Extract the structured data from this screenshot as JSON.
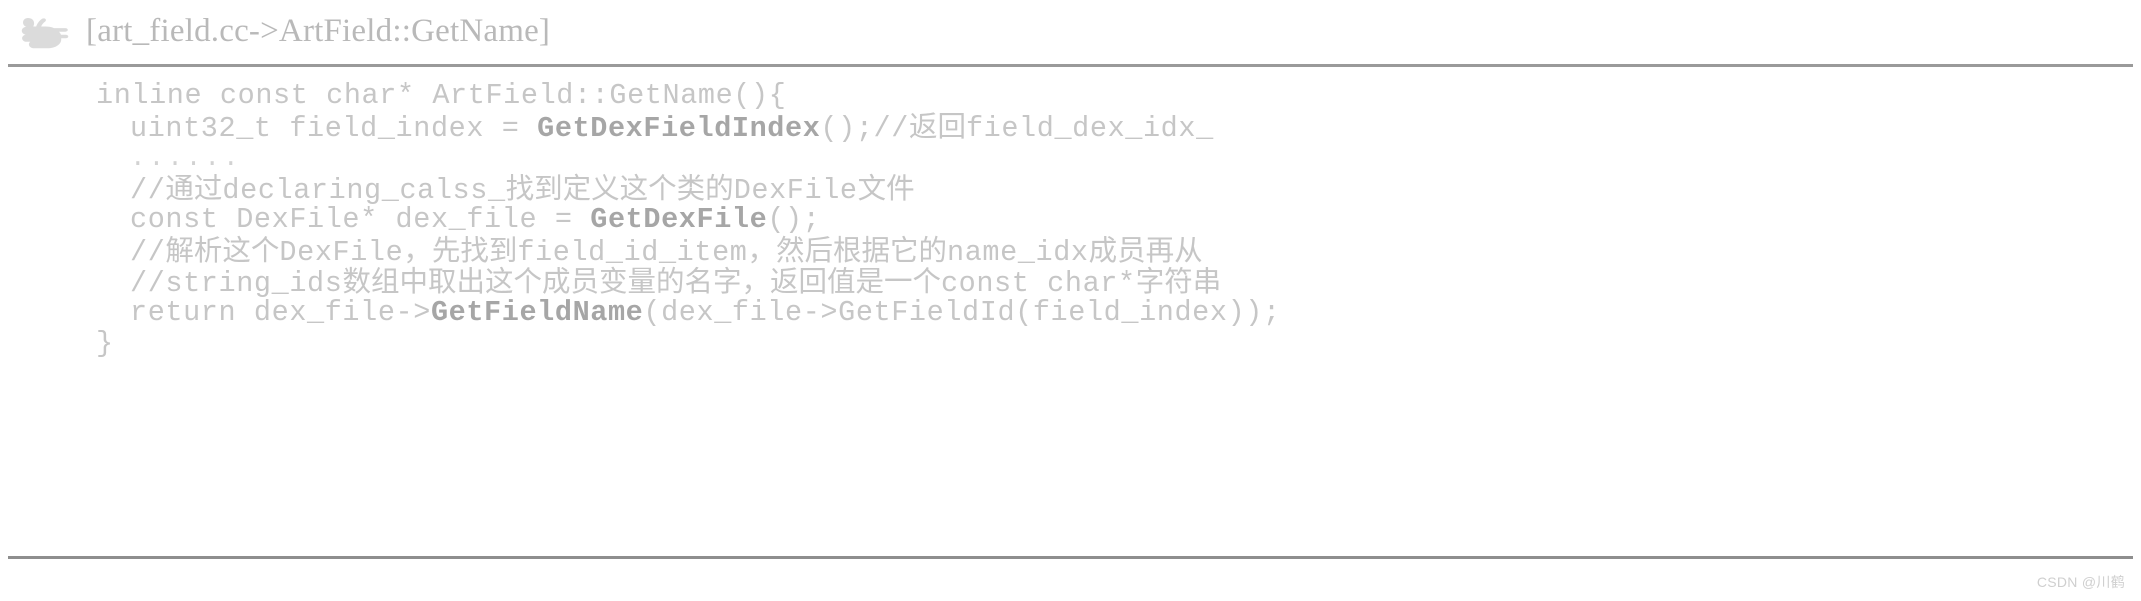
{
  "header": {
    "icon": "pointing-hand-icon",
    "title": "[art_field.cc->ArtField::GetName]"
  },
  "code": {
    "language": "cpp",
    "lines": [
      {
        "id": "line-1",
        "indent": 1,
        "segments": [
          {
            "kind": "plain",
            "text": "inline const char* ArtField::GetName(){"
          }
        ]
      },
      {
        "id": "line-2",
        "indent": 2,
        "segments": [
          {
            "kind": "plain",
            "text": "uint32_t field_index = "
          },
          {
            "kind": "bold",
            "text": "GetDexFieldIndex"
          },
          {
            "kind": "plain",
            "text": "();//"
          },
          {
            "kind": "cjk",
            "text": "返回"
          },
          {
            "kind": "plain",
            "text": "field_dex_idx_"
          }
        ]
      },
      {
        "id": "line-3",
        "indent": 2,
        "segments": [
          {
            "kind": "dots",
            "text": "......"
          }
        ]
      },
      {
        "id": "line-4",
        "indent": 2,
        "segments": [
          {
            "kind": "plain",
            "text": "//"
          },
          {
            "kind": "cjk",
            "text": "通过"
          },
          {
            "kind": "plain",
            "text": "declaring_calss_"
          },
          {
            "kind": "cjk",
            "text": "找到定义这个类的"
          },
          {
            "kind": "plain",
            "text": "DexFile"
          },
          {
            "kind": "cjk",
            "text": "文件"
          }
        ]
      },
      {
        "id": "line-5",
        "indent": 2,
        "segments": [
          {
            "kind": "plain",
            "text": "const DexFile* dex_file = "
          },
          {
            "kind": "bold",
            "text": "GetDexFile"
          },
          {
            "kind": "plain",
            "text": "();"
          }
        ]
      },
      {
        "id": "line-6",
        "indent": 2,
        "segments": [
          {
            "kind": "plain",
            "text": "//"
          },
          {
            "kind": "cjk",
            "text": "解析这个"
          },
          {
            "kind": "plain",
            "text": "DexFile"
          },
          {
            "kind": "cjk",
            "text": "，先找到"
          },
          {
            "kind": "plain",
            "text": "field_id_item"
          },
          {
            "kind": "cjk",
            "text": "，然后根据它的"
          },
          {
            "kind": "plain",
            "text": "name_idx"
          },
          {
            "kind": "cjk",
            "text": "成员再从"
          }
        ]
      },
      {
        "id": "line-7",
        "indent": 2,
        "segments": [
          {
            "kind": "plain",
            "text": "//string_ids"
          },
          {
            "kind": "cjk",
            "text": "数组中取出这个成员变量的名字，返回值是一个"
          },
          {
            "kind": "plain",
            "text": "const char*"
          },
          {
            "kind": "cjk",
            "text": "字符串"
          }
        ]
      },
      {
        "id": "line-8",
        "indent": 2,
        "segments": [
          {
            "kind": "plain",
            "text": "return dex_file->"
          },
          {
            "kind": "bold",
            "text": "GetFieldName"
          },
          {
            "kind": "plain",
            "text": "(dex_file->GetFieldId(field_index));"
          }
        ]
      },
      {
        "id": "line-9",
        "indent": 1,
        "segments": [
          {
            "kind": "plain",
            "text": "}"
          }
        ]
      }
    ]
  },
  "watermark": {
    "text": "CSDN @川鹤"
  },
  "colors": {
    "page_background": "#ffffff",
    "header_text": "#b9b9b9",
    "code_text": "#c6c6c6",
    "code_bold_text": "#a6a6a6",
    "rule": "#9a9a9a",
    "watermark": "#cfcfcf"
  }
}
